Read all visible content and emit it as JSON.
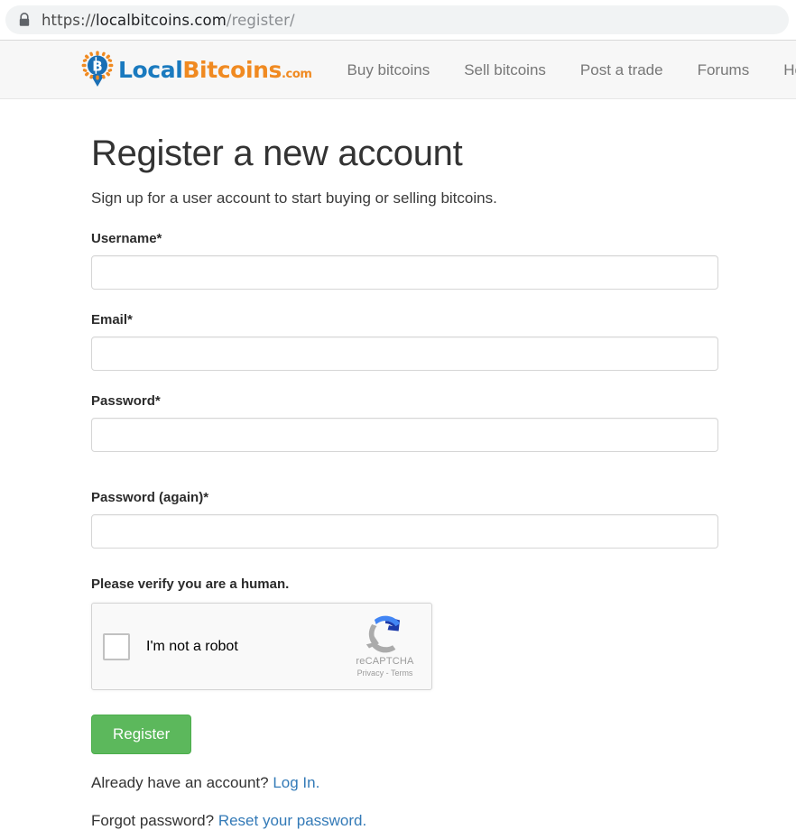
{
  "browser": {
    "lock_icon": "lock-icon",
    "url_scheme": "https://",
    "url_host": "localbitcoins.com",
    "url_path": "/register/"
  },
  "header": {
    "brand": {
      "logo_icon": "localbitcoins-pin-logo",
      "name_first": "Local",
      "name_second": "Bitcoins",
      "name_tld": ".com"
    },
    "nav": [
      {
        "label": "Buy bitcoins",
        "has_caret": false
      },
      {
        "label": "Sell bitcoins",
        "has_caret": false
      },
      {
        "label": "Post a trade",
        "has_caret": false
      },
      {
        "label": "Forums",
        "has_caret": false
      },
      {
        "label": "Help",
        "has_caret": true
      }
    ]
  },
  "main": {
    "title": "Register a new account",
    "subtitle": "Sign up for a user account to start buying or selling bitcoins.",
    "fields": {
      "username": {
        "label": "Username*",
        "value": "",
        "placeholder": ""
      },
      "email": {
        "label": "Email*",
        "value": "",
        "placeholder": ""
      },
      "password": {
        "label": "Password*",
        "value": "",
        "placeholder": ""
      },
      "password_again": {
        "label": "Password (again)*",
        "value": "",
        "placeholder": ""
      }
    },
    "captcha": {
      "heading": "Please verify you are a human.",
      "checkbox_label": "I'm not a robot",
      "logo_icon": "recaptcha-arrows-icon",
      "brand_name": "reCAPTCHA",
      "privacy_label": "Privacy",
      "separator": "-",
      "terms_label": "Terms"
    },
    "submit_label": "Register",
    "login_prompt": "Already have an account?",
    "login_link": "Log In.",
    "forgot_prompt": "Forgot password?",
    "reset_link": "Reset your password."
  },
  "colors": {
    "brand_blue": "#1a7abf",
    "brand_orange": "#f08a21",
    "button_green": "#5cb85c",
    "link_blue": "#337ab7",
    "header_bg": "#f7f7f7"
  }
}
